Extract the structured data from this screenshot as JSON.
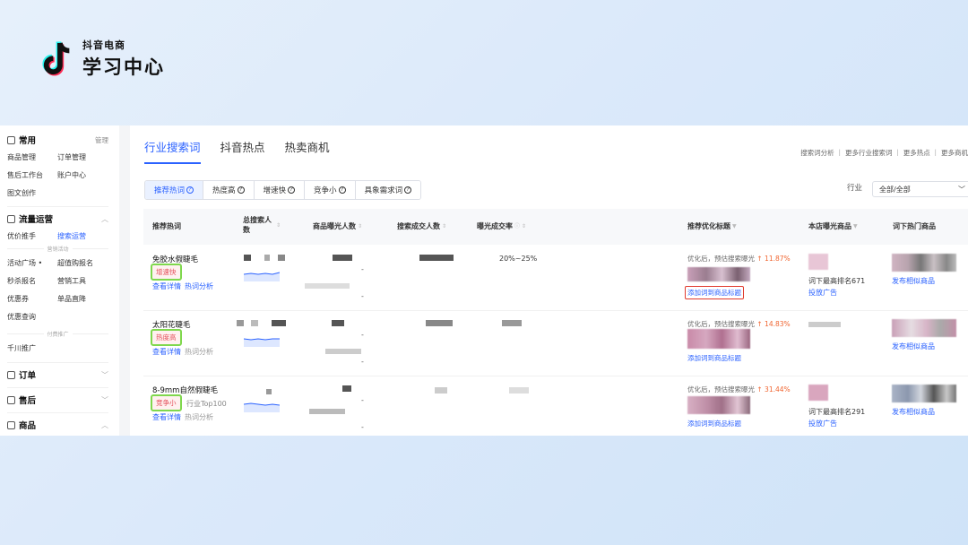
{
  "brand": {
    "sub": "抖音电商",
    "main": "学习中心"
  },
  "sidebar": {
    "common": {
      "title": "常用",
      "action": "管理",
      "items": [
        "商品管理",
        "订单管理",
        "售后工作台",
        "账户中心",
        "图文创作"
      ]
    },
    "traffic": {
      "title": "流量运营",
      "items": [
        "优价推手",
        "搜索运营"
      ],
      "group1": "营销活动",
      "group1_items": [
        "活动广场",
        "超值购报名",
        "秒杀报名",
        "营销工具",
        "优惠券",
        "单品直降",
        "优惠查询"
      ],
      "group2": "付费推广",
      "group2_items": [
        "千川推广"
      ]
    },
    "orders": "订单",
    "aftersale": "售后",
    "products": "商品"
  },
  "tabs": [
    "行业搜索词",
    "抖音热点",
    "热卖商机"
  ],
  "top_links": "搜索词分析 ｜ 更多行业搜索词 ｜ 更多热点 ｜ 更多商机",
  "chips": [
    "推荐热词",
    "热度高",
    "增速快",
    "竞争小",
    "具象需求词"
  ],
  "industry_label": "行业",
  "industry_value": "全部/全部",
  "headers": {
    "keyword": "推荐热词",
    "total_search": "总搜索人数",
    "exposure": "商品曝光人数",
    "deal": "搜索成交人数",
    "rate": "曝光成交率",
    "title_opt": "推荐优化标题",
    "store": "本店曝光商品",
    "hot": "词下热门商品"
  },
  "rows": [
    {
      "keyword": "免胶水假睫毛",
      "tag": "增速快",
      "rank": "",
      "detail": "查看详情",
      "analysis": "热词分析",
      "rate": "20%~25%",
      "opt": "优化后，预估搜索曝光",
      "growth": "↑ 11.87%",
      "add": "添加词到商品标题",
      "store_rank": "词下最高排名671",
      "store_ad": "投放广告",
      "publish": "发布相似商品"
    },
    {
      "keyword": "太阳花睫毛",
      "tag": "热度高",
      "rank": "",
      "detail": "查看详情",
      "analysis": "热词分析",
      "rate": "",
      "opt": "优化后，预估搜索曝光",
      "growth": "↑ 14.83%",
      "add": "添加词到商品标题",
      "store_rank": "",
      "store_ad": "",
      "publish": "发布相似商品"
    },
    {
      "keyword": "8-9mm自然假睫毛",
      "tag": "竞争小",
      "rank": "行业Top100",
      "detail": "查看详情",
      "analysis": "热词分析",
      "rate": "",
      "opt": "优化后，预估搜索曝光",
      "growth": "↑ 31.44%",
      "add": "添加词到商品标题",
      "store_rank": "词下最高排名291",
      "store_ad": "投放广告",
      "publish": "发布相似商品"
    }
  ],
  "colors": {
    "accent": "#2b62ff",
    "highlight_box": "#7fd84d",
    "red_box": "#e03a2e",
    "growth": "#f0642f"
  }
}
